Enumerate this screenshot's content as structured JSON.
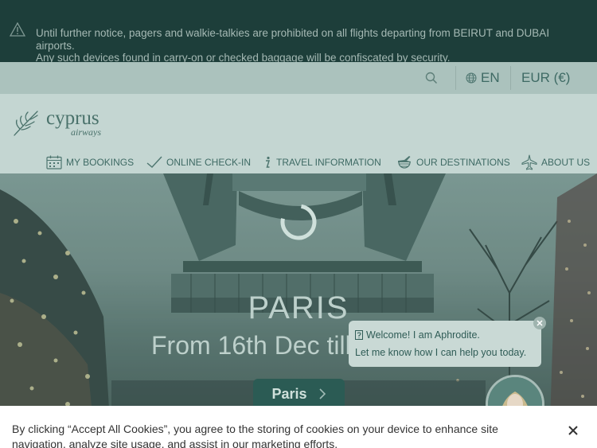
{
  "notice": {
    "line1": "Until further notice, pagers and walkie-talkies are prohibited on all flights departing from BEIRUT and DUBAI airports.",
    "line2": "Any such devices found in carry-on or checked baggage will be confiscated by security.",
    "icon": "warning-icon"
  },
  "utility": {
    "search_icon": "search-icon",
    "language": "EN",
    "language_icon": "globe-icon",
    "currency": "EUR (€)"
  },
  "brand": {
    "name": "cyprus",
    "tagline": "airways",
    "icon": "olive-branch-icon"
  },
  "nav": [
    {
      "label": "MY BOOKINGS",
      "icon": "calendar-icon"
    },
    {
      "label": "ONLINE CHECK-IN",
      "icon": "checkmark-icon"
    },
    {
      "label": "TRAVEL INFORMATION",
      "icon": "info-icon"
    },
    {
      "label": "OUR DESTINATIONS",
      "icon": "globe-plane-icon"
    },
    {
      "label": "ABOUT US",
      "icon": "airplane-icon"
    }
  ],
  "hero": {
    "title": "PARIS",
    "subtitle": "From 16th Dec till",
    "cta_label": "Paris"
  },
  "chat": {
    "greeting": "Welcome! I am Aphrodite.",
    "message": "Let me know how I can help you today."
  },
  "cookie": {
    "text": "By clicking “Accept All Cookies”, you agree to the storing of cookies on your device to enhance site navigation, analyze site usage, and assist in our marketing efforts."
  },
  "colors": {
    "notice_bg": "#1d3e3a",
    "accent": "#2b5b54",
    "header_bg": "#c4d6d2"
  }
}
